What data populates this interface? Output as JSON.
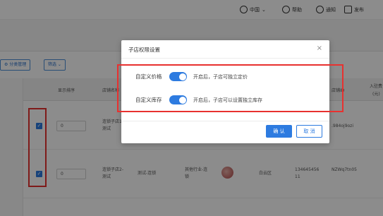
{
  "topbar": {
    "region": "中国",
    "help": "帮助",
    "notify": "通知",
    "publish": "发布"
  },
  "toolbar": {
    "category_btn": "分类管理",
    "filter_btn": "筛选"
  },
  "table": {
    "headers": {
      "sort": "显示排序",
      "store_name": "店铺名称",
      "store_id": "店铺ID",
      "settle": "入驻费",
      "unit": "(元)"
    },
    "rows": [
      {
        "checked": true,
        "sort": "0",
        "name": "连锁子店1-测试",
        "id": ".984oj9ozi"
      },
      {
        "checked": true,
        "sort": "0",
        "name": "连锁子店2-测试",
        "type": "测试-连锁",
        "industry": "其他行业-连锁",
        "region": "白云区",
        "phone": "13464545611",
        "id": "NZWq7tn05"
      }
    ]
  },
  "modal": {
    "title": "子店权限设置",
    "close": "×",
    "options": [
      {
        "label": "自定义价格",
        "on": true,
        "desc": "开启后，子店可独立定价"
      },
      {
        "label": "自定义库存",
        "on": true,
        "desc": "开启后，子店可以设置独立库存"
      }
    ],
    "confirm": "确 认",
    "cancel": "取 消"
  },
  "colors": {
    "accent": "#2d7be0",
    "highlight": "#e8312f"
  }
}
